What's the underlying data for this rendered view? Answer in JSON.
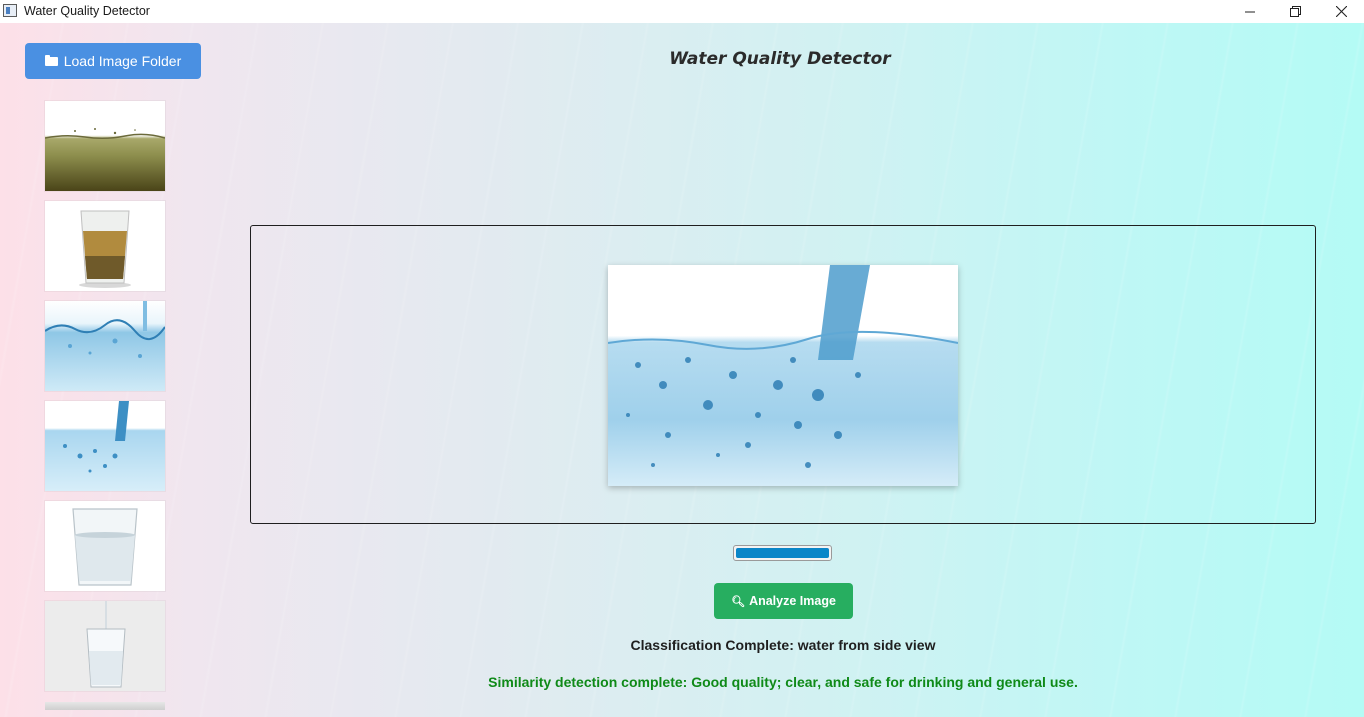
{
  "window": {
    "title": "Water Quality Detector",
    "controls": [
      "minimize-icon",
      "maximize-icon",
      "close-icon"
    ]
  },
  "toolbar": {
    "load_button_icon": "folder-icon",
    "load_button_label": "Load Image Folder"
  },
  "header": {
    "title": "Water Quality Detector"
  },
  "thumbnails": [
    {
      "subject": "murky greenish water surface"
    },
    {
      "subject": "glass of brown tea-like water"
    },
    {
      "subject": "blue water splash surface"
    },
    {
      "subject": "water pouring into blue water, side view"
    },
    {
      "subject": "glass of clear water"
    },
    {
      "subject": "water pouring into a glass"
    },
    {
      "subject": "partially visible thumbnail"
    }
  ],
  "preview": {
    "subject": "water from side view"
  },
  "progress": {
    "value": 1.0
  },
  "actions": {
    "analyze_icon": "search-icon",
    "analyze_label": "Analyze Image"
  },
  "results": {
    "classification": "Classification Complete: water from side view",
    "similarity": "Similarity detection complete: Good quality; clear, and safe for drinking and general use."
  },
  "colors": {
    "load_button": "#4a90e2",
    "analyze_button": "#27ae60",
    "progress_fill": "#0a86c8",
    "similarity_text": "#0f8a18"
  }
}
